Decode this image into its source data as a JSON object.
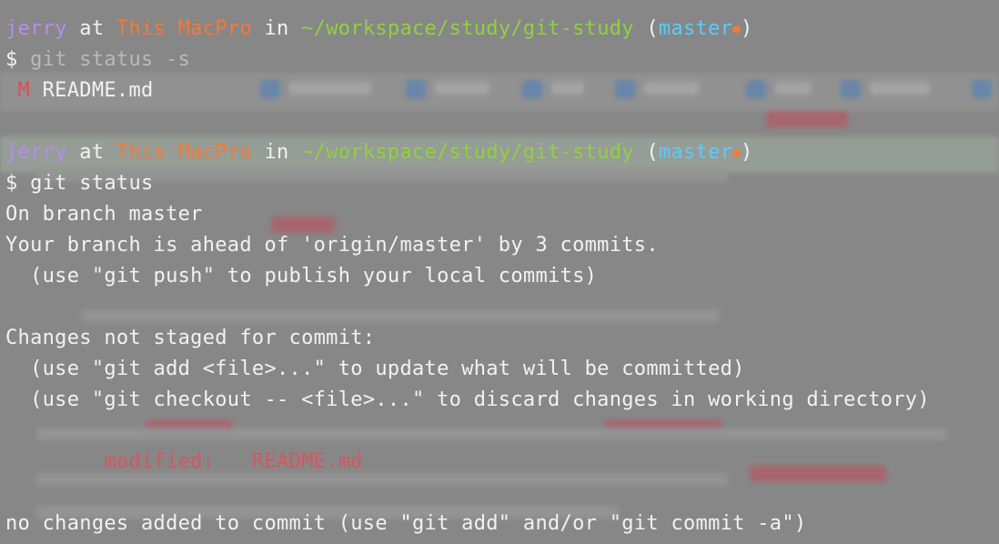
{
  "prompt": {
    "user": "jerry",
    "at": "at",
    "host": "This MacPro",
    "in": "in",
    "path": "~/workspace/study/git-study",
    "branch": "master",
    "dirty_marker": "●"
  },
  "block1": {
    "command_dollar": "$",
    "command": "git status -s",
    "status_flag": "M",
    "status_file": "README.md"
  },
  "block2": {
    "command_dollar": "$",
    "command": "git status",
    "lines": [
      "On branch master",
      "Your branch is ahead of 'origin/master' by 3 commits.",
      "  (use \"git push\" to publish your local commits)",
      "",
      "Changes not staged for commit:",
      "  (use \"git add <file>...\" to update what will be committed)",
      "  (use \"git checkout -- <file>...\" to discard changes in working directory)",
      ""
    ],
    "modified_label": "modified:",
    "modified_file": "README.md",
    "footer": "no changes added to commit (use \"git add\" and/or \"git commit -a\")"
  },
  "colors": {
    "user": "#b58cf0",
    "host": "#f07a3a",
    "path": "#8fd13f",
    "branch": "#5fcaf5",
    "modified": "#d8555e",
    "text": "#f2f2f2"
  }
}
